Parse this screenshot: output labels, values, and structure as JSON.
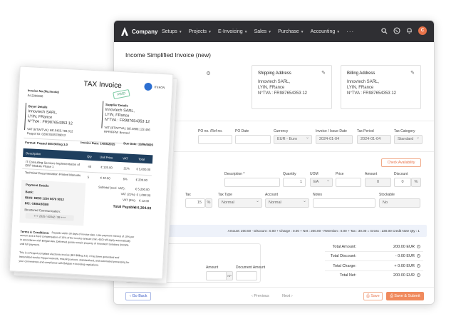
{
  "app": {
    "brand": "Company",
    "nav": [
      "Setups",
      "Projects",
      "E-Invoicing",
      "Sales",
      "Purchase",
      "Accounting"
    ],
    "nav_more": "···",
    "avatar_initial": "C"
  },
  "page": {
    "title": "Income Simplified Invoice (new)"
  },
  "shipping": {
    "title": "Shipping Address",
    "company": "Innovtech SARL,",
    "city": "LYIN, FRance",
    "vat": "N°TVA : FR987654353 12"
  },
  "billing": {
    "title": "Billing Address",
    "company": "Innovtech SARL,",
    "city": "LYIN, FRance",
    "vat": "N°TVA : FR987654353 12"
  },
  "header_fields": {
    "po_no_label": "PO no. /Ref no.",
    "po_date_label": "PO Date",
    "currency_label": "Currency",
    "currency_value": "EUR - Euro",
    "invoice_date_label": "Invoice / Issue Date",
    "invoice_date_value": "2024-01-04",
    "tax_period_label": "Tax Period",
    "tax_period_value": "2024-01-04",
    "tax_category_label": "Tax Category",
    "tax_category_value": "Standard"
  },
  "line": {
    "check_availability": "Check Availability",
    "description_label": "Description *",
    "quantity_label": "Quantity",
    "quantity_value": "1",
    "uom_label": "UOM",
    "uom_value": "EA",
    "price_label": "Price",
    "amount_label": "Amount",
    "amount_value": "0",
    "discount_label": "Discount",
    "discount_value": "0",
    "discount_unit": "%",
    "tax_label": "Tax",
    "tax_value": "15",
    "tax_unit": "%",
    "tax_type_label": "Tax Type",
    "tax_type_value": "Normal",
    "account_label": "Account",
    "account_value": "Normal",
    "notes_label": "Notes",
    "stockable_label": "Stockable",
    "stockable_value": "No"
  },
  "summary": "Amount: 200.00 - Discount : 0.00 + Charge : 0.00 + Net : 200.00 - Retention : 0.00 + Tax : 30.00 = Gross : 230.00 Credit Note Qty : 1",
  "inner": {
    "amount_label": "Amount",
    "document_amount_label": "Document Amount",
    "np": "NP"
  },
  "totals": [
    {
      "label": "Total Amount:",
      "value": "200.00 EUR"
    },
    {
      "label": "Total Discount:",
      "value": "- 0.00 EUR"
    },
    {
      "label": "Total Charge:",
      "value": "+ 0.00 EUR"
    },
    {
      "label": "Total Net:",
      "value": "200.00 EUR"
    }
  ],
  "footer": {
    "go_back": "Go Back",
    "previous": "‹ Previous",
    "next": "Next ›",
    "save": "Save",
    "save_submit": "Save & Submit"
  },
  "invoice": {
    "title": "TAX Invoice",
    "paid": "PAID",
    "logo": "ITEKON",
    "invoice_no_label": "Invoice No (No.incole)",
    "invoice_no": "IN-2300338",
    "buyer_label": "Buyer Details",
    "buyer_name": "Innovtech SARL,",
    "buyer_city": "LYIN, FRance",
    "buyer_vat": "N°TVA : FR987654353 12",
    "buyer_vat2": "VAT (BTW/TVA): BE.0455.789.012",
    "buyer_peppol": "Peppol ID: 0208:0455789012",
    "supplier_label": "Supplier Details",
    "supplier_name": "Innovtech SARL,",
    "supplier_city": "LYIN, FRance",
    "supplier_vat": "N°TVA : FR987654353 12",
    "supplier_vat2": "VAT (BTW/TVA): BE.0888.123.456",
    "supplier_addr": "RPR/RPM: Brussel",
    "format": "Format: Peppol BIS Billing 3.0",
    "invoice_date": "Invoice Date: 14/05/2025",
    "due_date": "Due Date: 13/06/2025",
    "col_description": "Description",
    "col_qty": "Qty",
    "col_unit_price": "Unit Price",
    "col_vat": "VAT",
    "col_total": "Total",
    "row1_desc": "IT Consulting Services Implementation of ERP Module Phase 1",
    "row1_qty": "40",
    "row1_price": "€ 125.00",
    "row1_vat": "21%",
    "row1_total": "€ 5,000.00",
    "row2_desc": "Technical Documentation Printed Manuals",
    "row2_qty": "5",
    "row2_price": "€ 40.00",
    "row2_vat": "6%",
    "row2_total": "€ 200.00",
    "pay_label": "Payment Details",
    "bank_label": "Bank:",
    "iban": "IBAN: BE55 1234 5678 9012",
    "bic": "BIC: GEBABEBB",
    "structured": "Structured Communication:",
    "reference": "+++ 2025 / 00342 / 99 +++",
    "subtotal": "Subtotal (excl. VAT):",
    "subtotal_value": "€ 5,200.00",
    "vat21": "VAT (21%):",
    "vat21_value": "€ 1,092.00",
    "vat6": "VAT (6%):",
    "vat6_value": "€ 12.00",
    "total_payable": "Total Payable:",
    "total_payable_value": "€ 6,304.00",
    "terms_title": "Terms & Conditions:",
    "terms_1": "Payable within 30 days of invoice date. Late payment interest of 10% per",
    "terms_2": "annum and a fixed compensation of 10% of the invoice amount (min. €40) will apply automatically",
    "terms_3": "in accordance with Belgian law. Delivered goods remain property of Innovtech Solutions BV/SRL",
    "terms_4": "until full payment.",
    "footer_1": "This is a Peppol-compliant electronic invoice (BIS Billing 3.0). It has been generated and",
    "footer_2": "transmitted via the Peppol network, ensuring secure, standardised, and automated processing for",
    "footer_3": "your convenience and compliance with Belgian e-invoicing regulations."
  }
}
